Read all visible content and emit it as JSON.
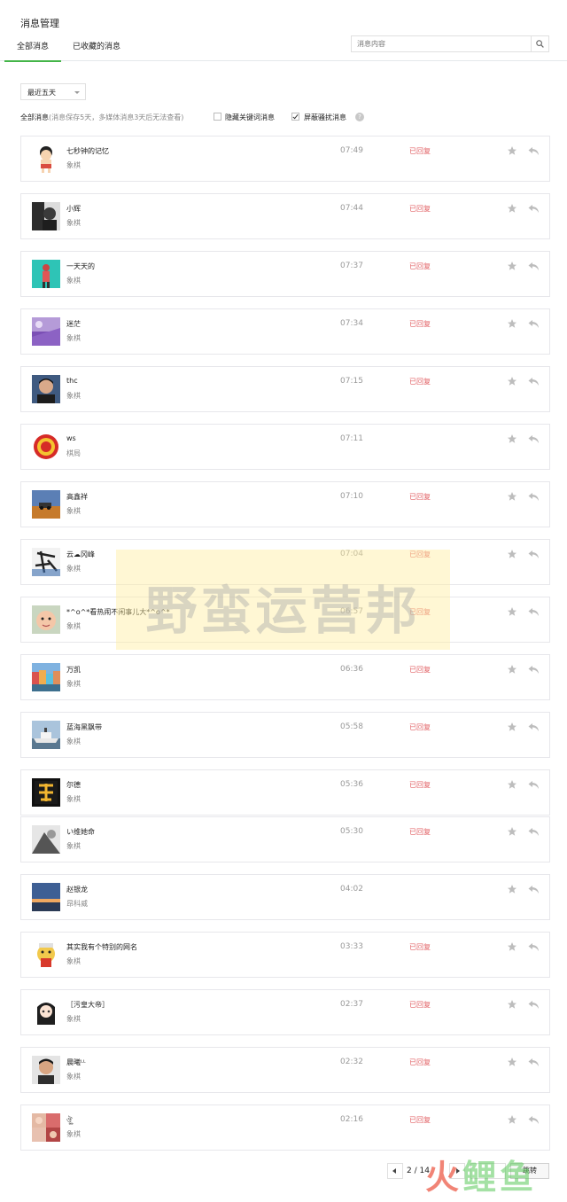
{
  "header": {
    "title": "消息管理"
  },
  "tabs": [
    {
      "label": "全部消息"
    },
    {
      "label": "已收藏的消息"
    }
  ],
  "search": {
    "placeholder": "消息内容"
  },
  "filter": {
    "range": "最近五天",
    "summary_strong": "全部消息",
    "summary_note": "(消息保存5天，多媒体消息3天后无法查看)",
    "hide_keywords_label": "隐藏关键词消息",
    "hide_keywords_checked": false,
    "block_spam_label": "屏蔽骚扰消息",
    "block_spam_checked": true,
    "help_icon": "?"
  },
  "colors": {
    "accent": "#44b549",
    "replied": "#e15f63",
    "muted": "#999999"
  },
  "messages": [
    {
      "name": "七秒钟的记忆",
      "group": "象棋",
      "time": "07:49",
      "status": "已回复",
      "avatar": "cartoon-boy"
    },
    {
      "name": "小辉",
      "group": "象棋",
      "time": "07:44",
      "status": "已回复",
      "avatar": "dark-portrait"
    },
    {
      "name": "一天天的",
      "group": "象棋",
      "time": "07:37",
      "status": "已回复",
      "avatar": "teal-figure"
    },
    {
      "name": "迷茫",
      "group": "象棋",
      "time": "07:34",
      "status": "已回复",
      "avatar": "purple-field"
    },
    {
      "name": "thc",
      "group": "象棋",
      "time": "07:15",
      "status": "已回复",
      "avatar": "young-man"
    },
    {
      "name": "ws",
      "group": "棋局",
      "time": "07:11",
      "status": "",
      "avatar": "red-emblem"
    },
    {
      "name": "高鑫祥",
      "group": "象棋",
      "time": "07:10",
      "status": "已回复",
      "avatar": "desert-car"
    },
    {
      "name": "云☁冈峰",
      "group": "象棋",
      "time": "07:04",
      "status": "已回复",
      "avatar": "calligraphy"
    },
    {
      "name": "*^o^*看热闹不闲事儿大*^o^*",
      "group": "象棋",
      "time": "06:57",
      "status": "已回复",
      "avatar": "baby-face"
    },
    {
      "name": "万凯",
      "group": "象棋",
      "time": "06:36",
      "status": "已回复",
      "avatar": "harbor-town"
    },
    {
      "name": "蓝海黑飘带",
      "group": "象棋",
      "time": "05:58",
      "status": "已回复",
      "avatar": "ship"
    },
    {
      "name": "尔德",
      "group": "象棋",
      "time": "05:36",
      "status": "已回复",
      "avatar": "fu-character"
    },
    {
      "name": "い维她命",
      "group": "象棋",
      "time": "05:30",
      "status": "已回复",
      "avatar": "bw-photo"
    },
    {
      "name": "赵银龙",
      "group": "昂科威",
      "time": "04:02",
      "status": "",
      "avatar": "sky-sunset"
    },
    {
      "name": "其实我有个特别的网名",
      "group": "象棋",
      "time": "03:33",
      "status": "已回复",
      "avatar": "cartoon-chef"
    },
    {
      "name": "［污皇大帝］",
      "group": "象棋",
      "time": "02:37",
      "status": "已回复",
      "avatar": "anime-girl"
    },
    {
      "name": "晨曦ᴸᴸ",
      "group": "象棋",
      "time": "02:32",
      "status": "已回复",
      "avatar": "man-portrait"
    },
    {
      "name": "ঔৣ",
      "group": "象棋",
      "time": "02:16",
      "status": "已回复",
      "avatar": "collage"
    }
  ],
  "pagination": {
    "page": "2 / 14",
    "go_label": "跳转"
  },
  "watermark": {
    "text": "野蛮运营邦"
  },
  "corner_logo": {
    "text_left": "火",
    "text_right": "鲤鱼"
  }
}
